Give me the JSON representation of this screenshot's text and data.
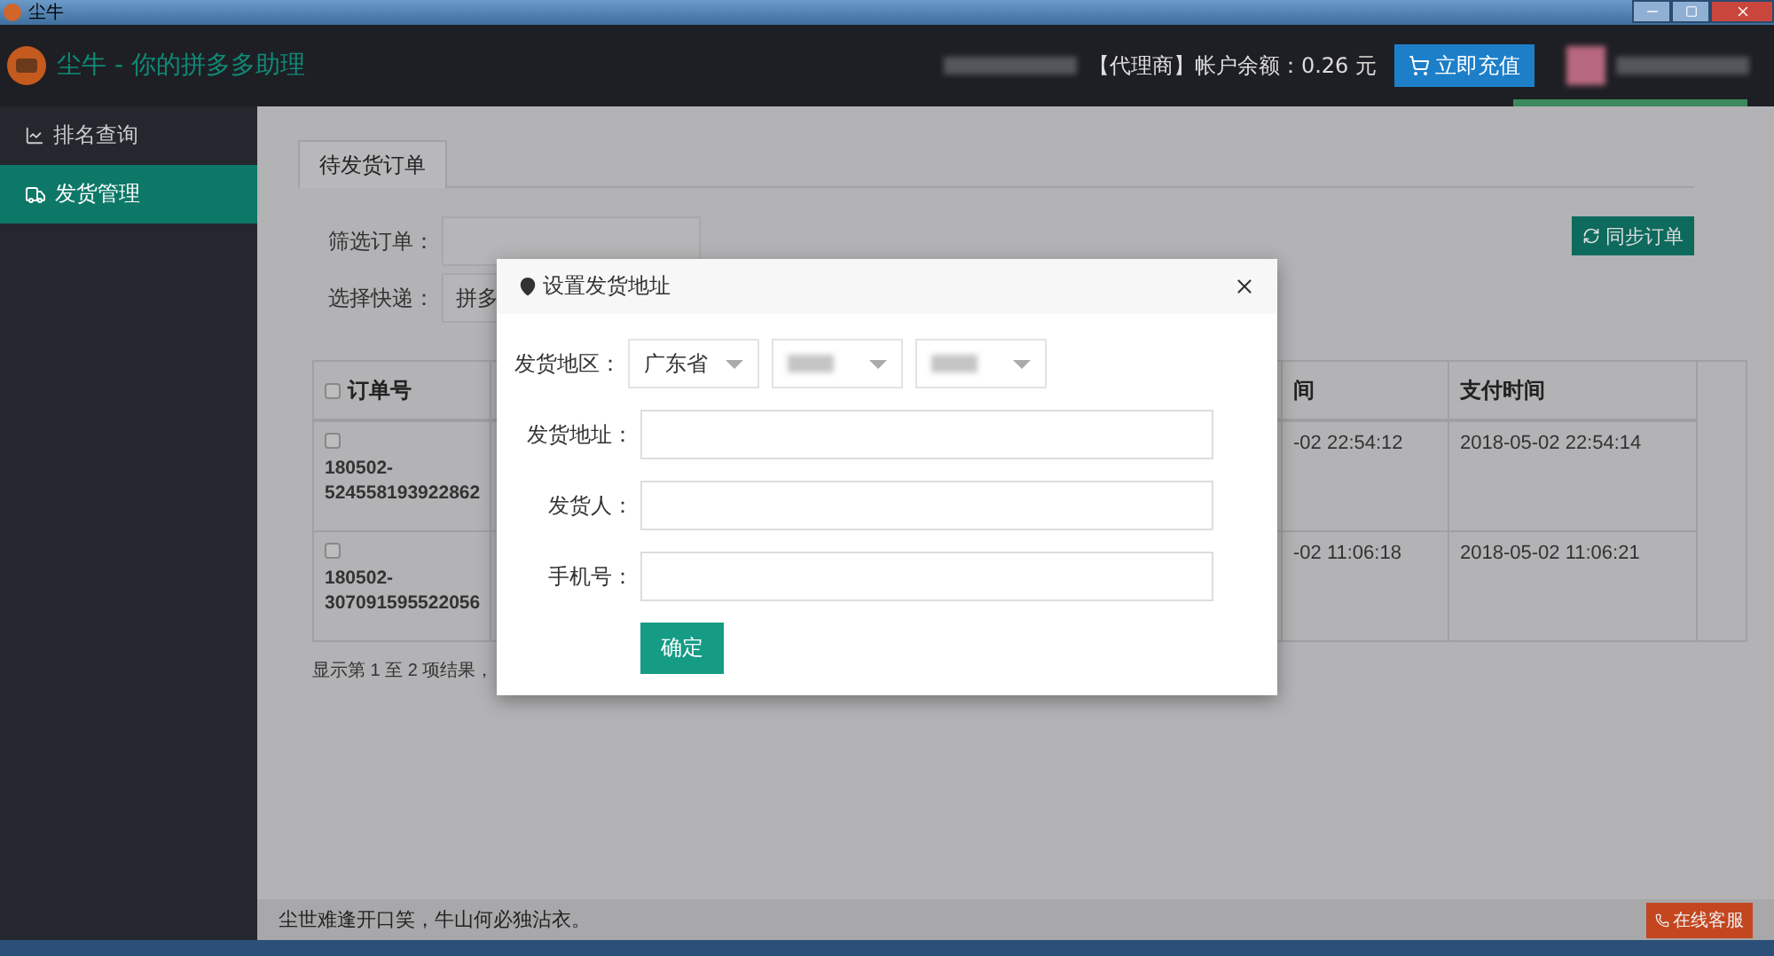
{
  "window": {
    "title": "尘牛"
  },
  "header": {
    "app_title": "尘牛 - 你的拼多多助理",
    "account": "【代理商】帐户余额：0.26 元",
    "recharge_button": "立即充值"
  },
  "sidebar": {
    "items": [
      {
        "label": "排名查询",
        "selected": false
      },
      {
        "label": "发货管理",
        "selected": true
      }
    ]
  },
  "tabs": [
    {
      "label": "待发货订单",
      "selected": true
    }
  ],
  "filters": [
    {
      "kind": "input",
      "label": "筛选订单："
    },
    {
      "kind": "select",
      "label": "选择快递：",
      "value": "拼多"
    }
  ],
  "sync_button": "同步订单",
  "table": {
    "columns": [
      {
        "label": "订单号",
        "checked": false
      },
      {
        "label": "间"
      },
      {
        "label": "支付时间"
      }
    ],
    "rows": [
      {
        "checked": false,
        "order_no": "180502-524558193922862",
        "column_3": "-02 22:54:12",
        "pay_time": "2018-05-02 22:54:14"
      },
      {
        "checked": false,
        "order_no": "180502-307091595522056",
        "column_3": "-02 11:06:18",
        "pay_time": "2018-05-02 11:06:21"
      }
    ]
  },
  "table_info": "显示第 1 至 2 项结果，",
  "footer": {
    "motto": "尘世难逢开口笑，牛山何必独沾衣。",
    "service_button": "在线客服"
  },
  "dialog": {
    "title": "设置发货地址",
    "fields": [
      {
        "kind": "region",
        "label": "发货地区：",
        "selects": [
          {
            "value": "广东省",
            "blurred": false
          },
          {
            "blurred": true
          },
          {
            "blurred": true
          }
        ]
      },
      {
        "kind": "text",
        "label": "发货地址："
      },
      {
        "kind": "text",
        "label": "发货人："
      },
      {
        "kind": "text",
        "label": "手机号："
      }
    ],
    "confirm_button": "确定"
  }
}
